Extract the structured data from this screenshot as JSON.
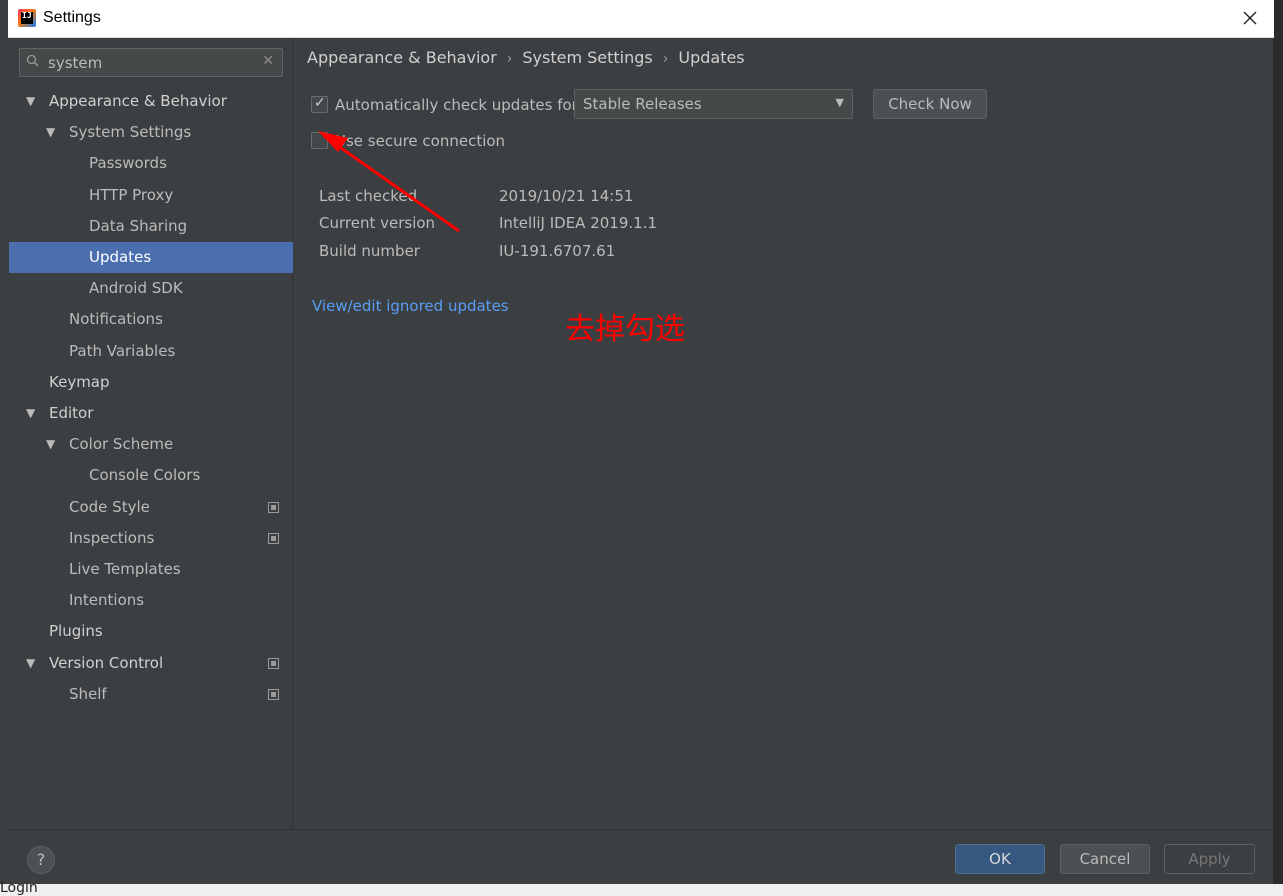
{
  "window": {
    "title": "Settings"
  },
  "background": {
    "bottom_text": "Login"
  },
  "sidebar": {
    "search": {
      "value": "system",
      "placeholder": ""
    },
    "items": [
      {
        "label": "Appearance & Behavior",
        "level": 0,
        "expanded": true,
        "bold": true
      },
      {
        "label": "System Settings",
        "level": 1,
        "expanded": true
      },
      {
        "label": "Passwords",
        "level": 2
      },
      {
        "label": "HTTP Proxy",
        "level": 2
      },
      {
        "label": "Data Sharing",
        "level": 2
      },
      {
        "label": "Updates",
        "level": 2,
        "selected": true
      },
      {
        "label": "Android SDK",
        "level": 2
      },
      {
        "label": "Notifications",
        "level": 1
      },
      {
        "label": "Path Variables",
        "level": 1
      },
      {
        "label": "Keymap",
        "level": 0,
        "bold": true
      },
      {
        "label": "Editor",
        "level": 0,
        "expanded": true,
        "bold": true
      },
      {
        "label": "Color Scheme",
        "level": 1,
        "expanded": true
      },
      {
        "label": "Console Colors",
        "level": 2
      },
      {
        "label": "Code Style",
        "level": 1,
        "project_icon": true
      },
      {
        "label": "Inspections",
        "level": 1,
        "project_icon": true
      },
      {
        "label": "Live Templates",
        "level": 1
      },
      {
        "label": "Intentions",
        "level": 1
      },
      {
        "label": "Plugins",
        "level": 0,
        "bold": true
      },
      {
        "label": "Version Control",
        "level": 0,
        "expanded": true,
        "bold": true,
        "project_icon": true
      },
      {
        "label": "Shelf",
        "level": 1,
        "project_icon": true
      }
    ]
  },
  "content": {
    "breadcrumb": [
      "Appearance & Behavior",
      "System Settings",
      "Updates"
    ],
    "auto_check": {
      "label": "Automatically check updates for",
      "checked": true
    },
    "channel_select": {
      "value": "Stable Releases"
    },
    "check_now_label": "Check Now",
    "secure_connection": {
      "label": "Use secure connection",
      "checked": false
    },
    "info": {
      "last_checked_label": "Last checked",
      "last_checked_value": "2019/10/21 14:51",
      "current_version_label": "Current version",
      "current_version_value": "IntelliJ IDEA 2019.1.1",
      "build_number_label": "Build number",
      "build_number_value": "IU-191.6707.61"
    },
    "ignored_link": "View/edit ignored updates",
    "annotation": {
      "text": "去掉勾选",
      "color": "#ff0000"
    }
  },
  "footer": {
    "help_label": "?",
    "ok_label": "OK",
    "cancel_label": "Cancel",
    "apply_label": "Apply"
  },
  "colors": {
    "background": "#3c3f41",
    "selection": "#4b6eaf",
    "link": "#589df6",
    "primary_button": "#365880"
  }
}
